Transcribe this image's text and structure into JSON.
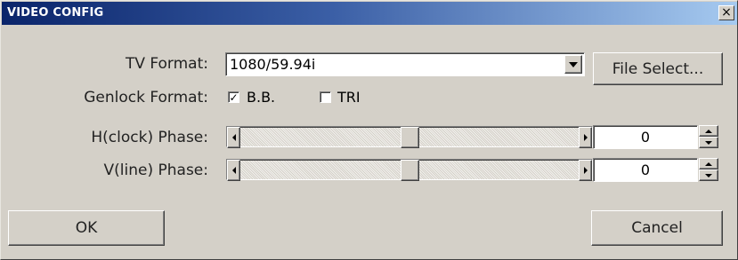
{
  "window": {
    "title": "VIDEO CONFIG",
    "close_glyph": "×"
  },
  "tv_format": {
    "label": "TV Format:",
    "value": "1080/59.94i",
    "file_select_label": "File Select..."
  },
  "genlock": {
    "label": "Genlock Format:",
    "options": [
      {
        "label": "B.B.",
        "checked": true,
        "mark": "✓"
      },
      {
        "label": "TRI",
        "checked": false,
        "mark": ""
      }
    ]
  },
  "h_phase": {
    "label": "H(clock) Phase:",
    "value": "0",
    "slider_fraction": 0.5
  },
  "v_phase": {
    "label": "V(line) Phase:",
    "value": "0",
    "slider_fraction": 0.5
  },
  "buttons": {
    "ok": "OK",
    "cancel": "Cancel"
  },
  "icons": [
    "close-icon",
    "dropdown-arrow-icon",
    "scroll-left-icon",
    "scroll-right-icon",
    "spin-up-icon",
    "spin-down-icon",
    "checkmark-icon"
  ]
}
